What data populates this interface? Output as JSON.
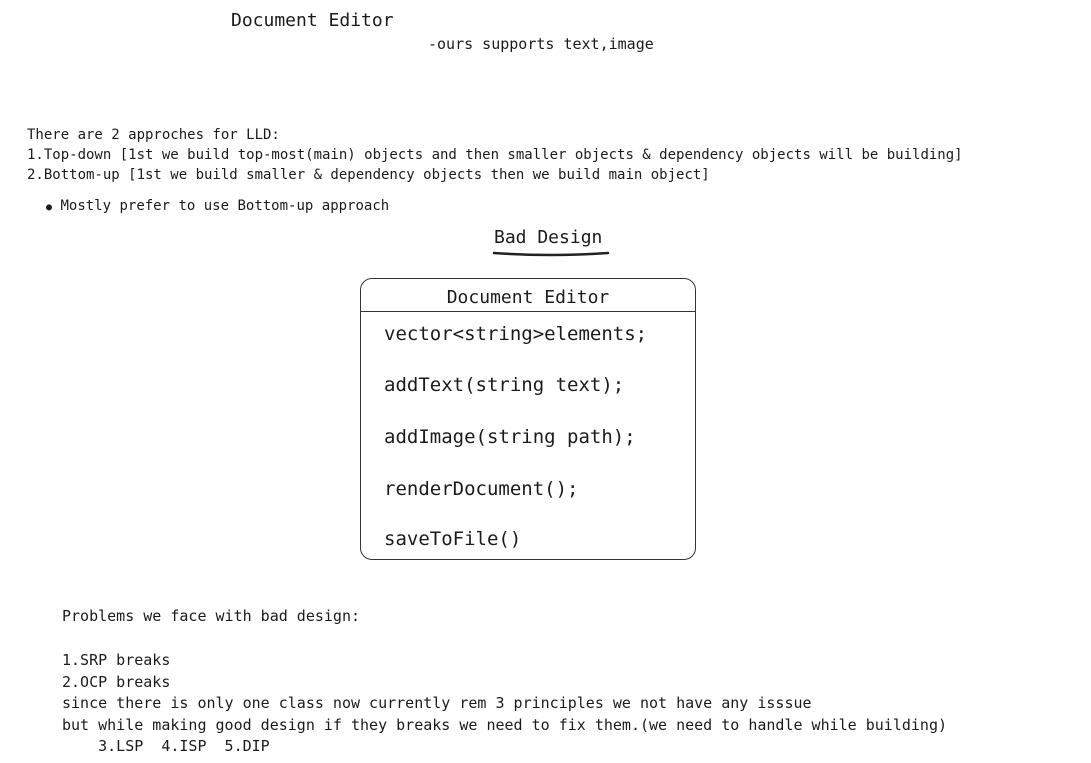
{
  "header": {
    "title": "Document Editor",
    "subtitle": "-ours supports text,image"
  },
  "approaches": {
    "intro": "There are 2 approches for LLD:",
    "items": [
      "1.Top-down [1st we build top-most(main) objects and then smaller objects & dependency objects will be building]",
      "2.Bottom-up [1st we build smaller & dependency objects then we build main object]"
    ],
    "bullet": "Mostly prefer to use Bottom-up approach"
  },
  "bad_design": {
    "heading": "Bad Design",
    "class_box": {
      "name": "Document Editor",
      "members": [
        "vector<string>elements;",
        "addText(string text);",
        "addImage(string path);",
        "renderDocument();",
        "saveToFile()"
      ]
    }
  },
  "problems": {
    "intro": "Problems we face with bad design:",
    "lines": [
      "1.SRP breaks",
      "2.OCP breaks",
      "since there is only one class now currently rem 3 principles we not have any isssue",
      "but while making good design if they breaks we need to fix them.(we need to handle while building)",
      "    3.LSP  4.ISP  5.DIP"
    ]
  }
}
